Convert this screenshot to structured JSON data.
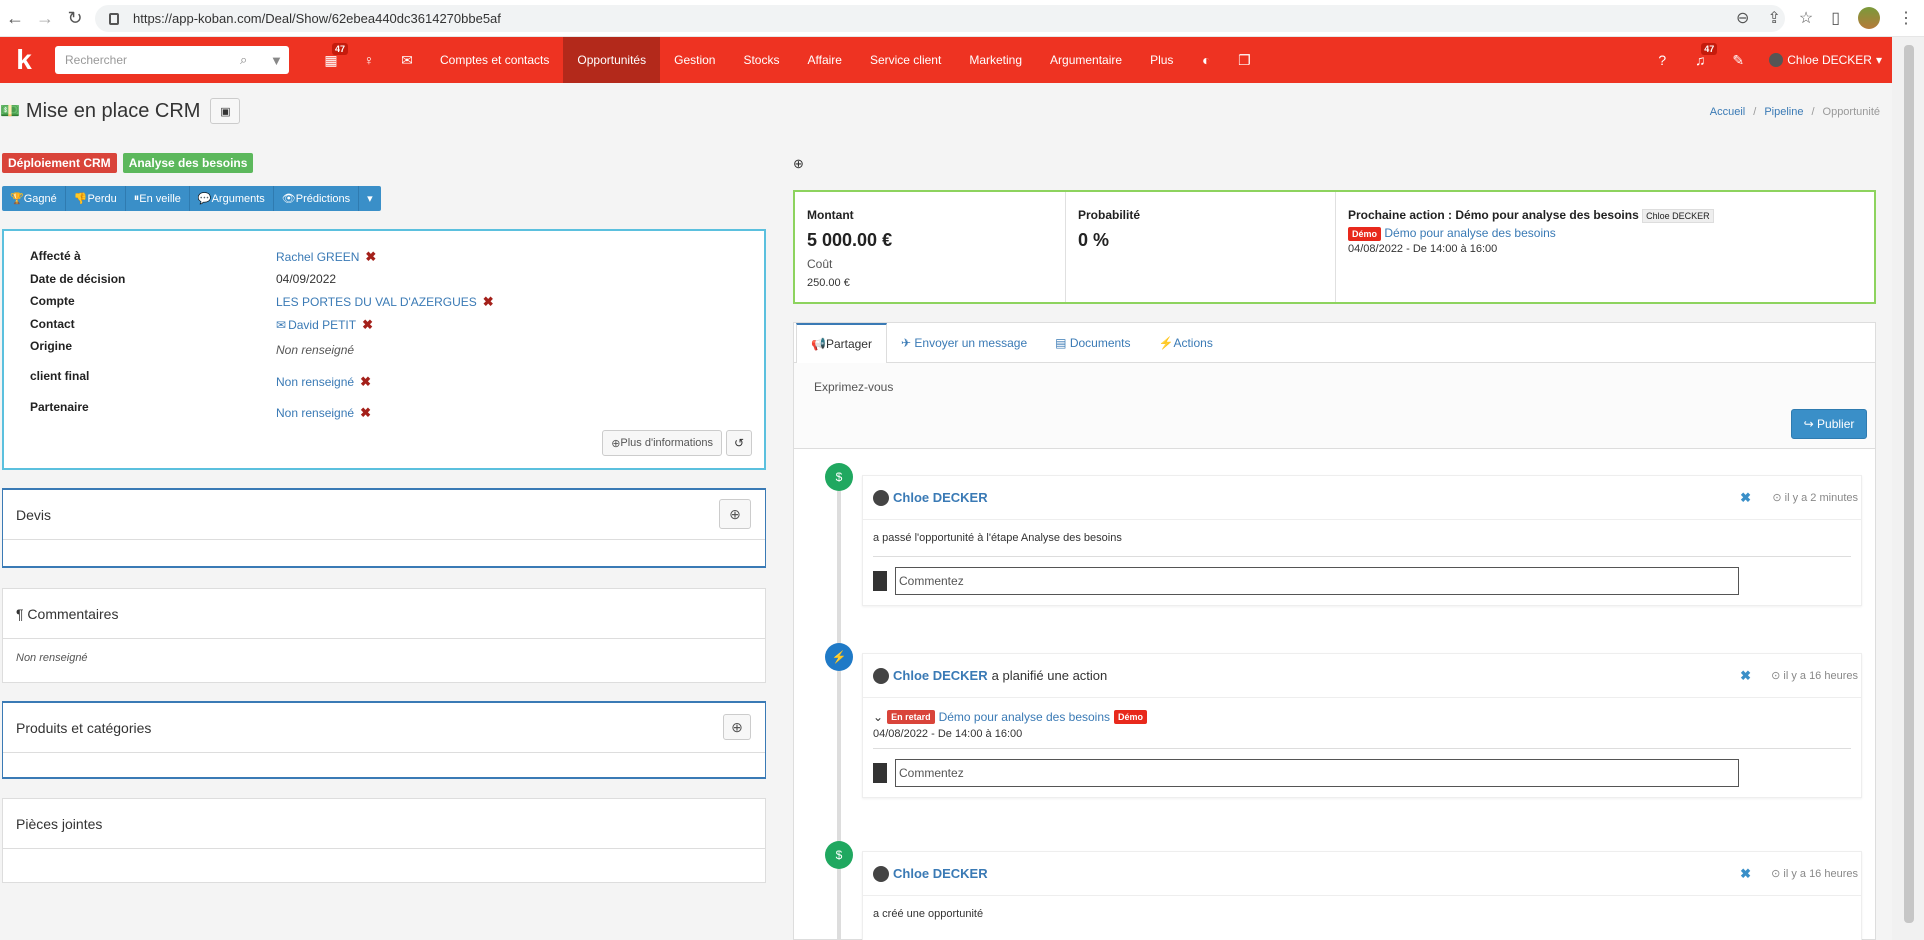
{
  "browser": {
    "url": "https://app-koban.com/Deal/Show/62ebea440dc3614270bbe5af"
  },
  "appnav": {
    "logo": "k",
    "search_placeholder": "Rechercher",
    "calendar_badge": "47",
    "notif_badge": "47",
    "links": [
      "Comptes et contacts",
      "Opportunités",
      "Gestion",
      "Stocks",
      "Affaire",
      "Service client",
      "Marketing",
      "Argumentaire",
      "Plus"
    ],
    "active_link": "Opportunités",
    "user": "Chloe DECKER",
    "accent": "#ee3322"
  },
  "page": {
    "title": "Mise en place CRM",
    "breadcrumb": [
      "Accueil",
      "Pipeline",
      "Opportunité"
    ]
  },
  "tags": [
    {
      "label": "Déploiement CRM",
      "color": "#d9443a"
    },
    {
      "label": "Analyse des besoins",
      "color": "#5cb85c"
    }
  ],
  "actions": [
    "Gagné",
    "Perdu",
    "En veille",
    "Arguments",
    "Prédictions"
  ],
  "info": {
    "rows": [
      {
        "label": "Affecté à",
        "value": "Rachel GREEN"
      },
      {
        "label": "Date de décision",
        "value": "04/09/2022"
      },
      {
        "label": "Compte",
        "value": "LES PORTES DU VAL D'AZERGUES"
      },
      {
        "label": "Contact",
        "value": "David PETIT"
      },
      {
        "label": "Origine",
        "value": "Non renseigné"
      },
      {
        "label": "client final",
        "value": "Non renseigné"
      },
      {
        "label": "Partenaire",
        "value": "Non renseigné"
      }
    ],
    "more_button": "Plus d'informations"
  },
  "sections": {
    "devis": "Devis",
    "commentaires": "Commentaires",
    "commentaires_body": "Non renseigné",
    "produits": "Produits et catégories",
    "pieces": "Pièces jointes"
  },
  "summary": {
    "montant_label": "Montant",
    "montant_value": "5 000.00 €",
    "cout_label": "Coût",
    "cout_value": "250.00 €",
    "proba_label": "Probabilité",
    "proba_value": "0 %",
    "next_label": "Prochaine action : Démo pour analyse des besoins",
    "next_user": "Chloe DECKER",
    "next_badge": "Démo",
    "next_link": "Démo pour analyse des besoins",
    "next_time": "04/08/2022 - De 14:00 à 16:00"
  },
  "feed": {
    "tabs": [
      "Partager",
      "Envoyer un message",
      "Documents",
      "Actions"
    ],
    "share_placeholder": "Exprimez-vous",
    "publish": "Publier",
    "comment_placeholder": "Commentez",
    "items": [
      {
        "user": "Chloe DECKER",
        "action": "",
        "time": "il y a 2 minutes",
        "body": "a passé l'opportunité à l'étape Analyse des besoins"
      },
      {
        "user": "Chloe DECKER",
        "action": "a planifié une action",
        "time": "il y a 16 heures",
        "late": "En retard",
        "link": "Démo pour analyse des besoins",
        "badge": "Démo",
        "when": "04/08/2022 - De 14:00 à 16:00"
      },
      {
        "user": "Chloe DECKER",
        "action": "",
        "time": "il y a 16 heures",
        "body": "a créé une opportunité"
      }
    ]
  }
}
